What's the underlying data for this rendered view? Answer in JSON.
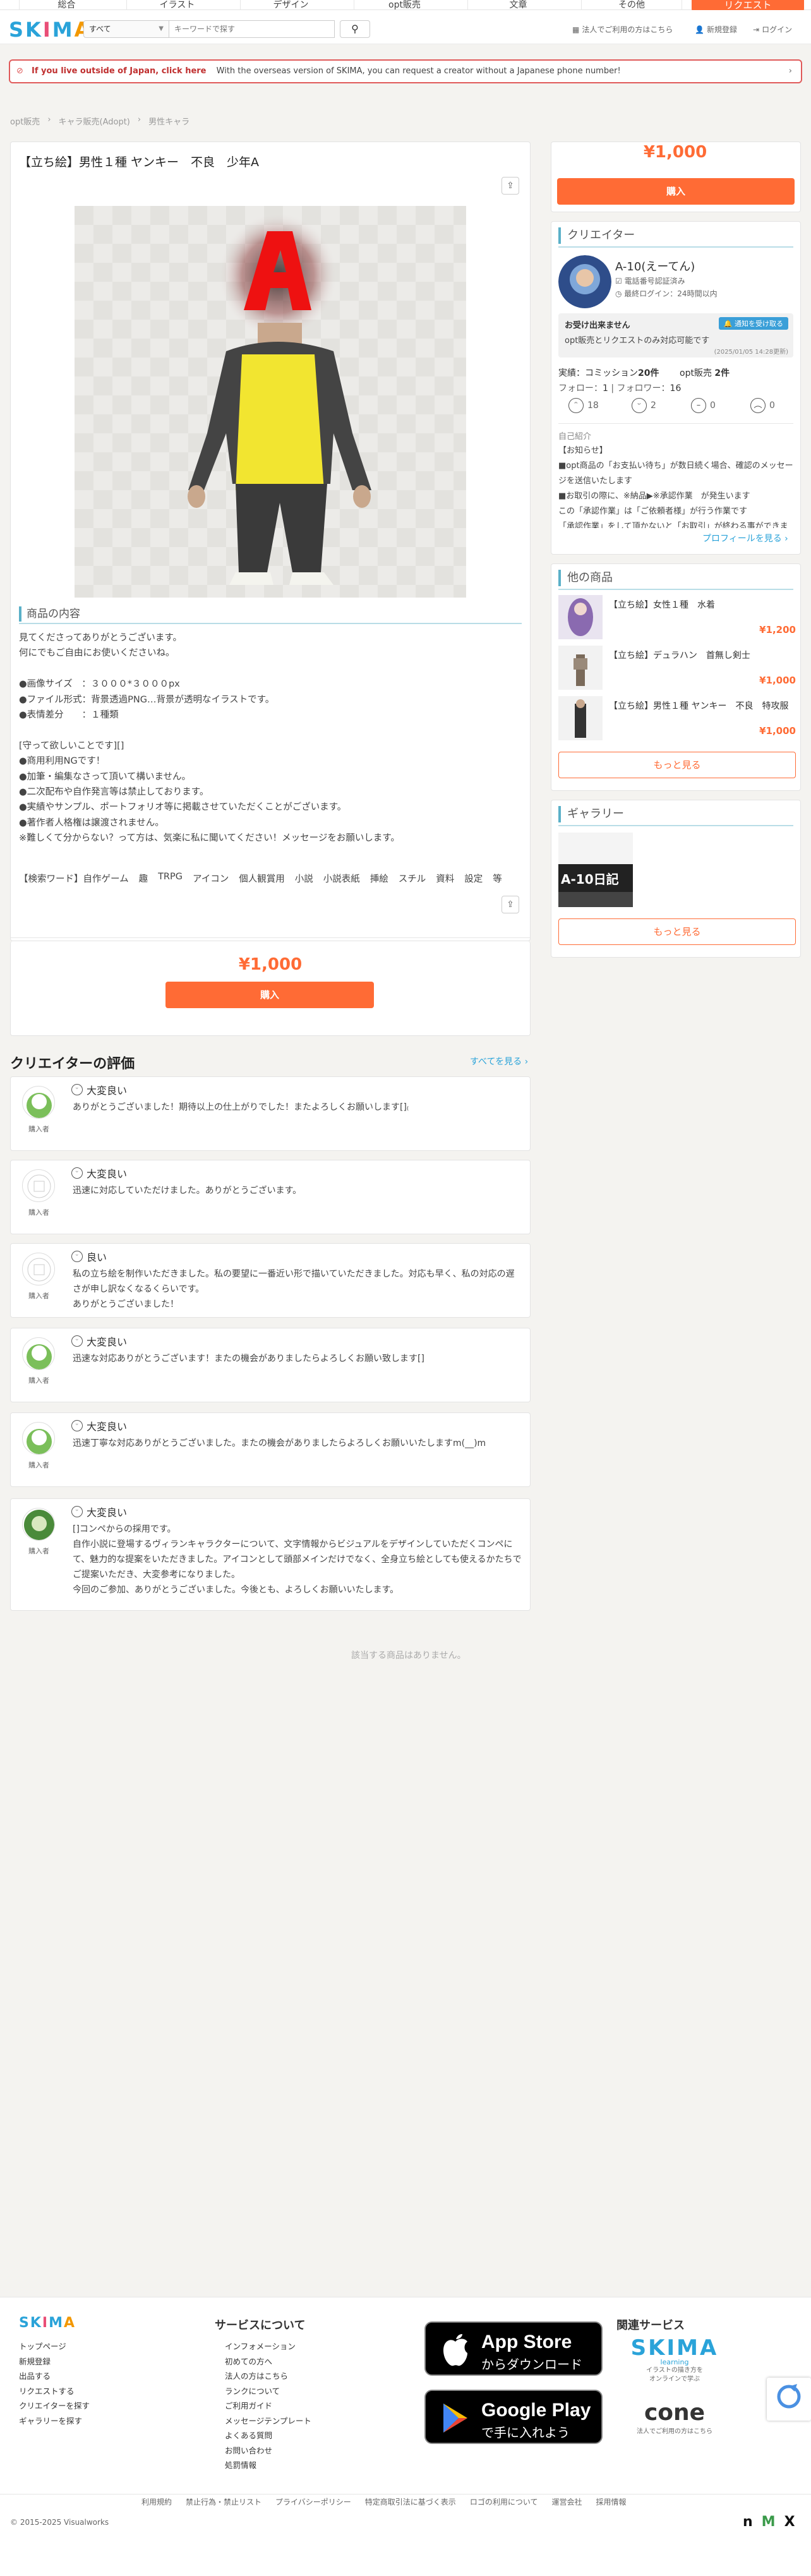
{
  "nav": {
    "items": [
      "総合",
      "イラスト",
      "デザイン",
      "opt販売",
      "文章",
      "その他"
    ],
    "request": "リクエスト"
  },
  "header": {
    "logo": [
      "S",
      "K",
      "I",
      "M",
      "A"
    ],
    "category": "すべて",
    "search_placeholder": "キーワードで探す",
    "corp_link": "法人でご利用の方はこちら",
    "signup": "新規登録",
    "login": "ログイン"
  },
  "banner": {
    "bold": "If you live outside of Japan, click here",
    "text": "With the overseas version of SKIMA, you can request a creator without a Japanese phone number!"
  },
  "breadcrumb": [
    "opt販売",
    "キャラ販売(Adopt)",
    "男性キャラ"
  ],
  "product": {
    "title": "【立ち絵】男性１種 ヤンキー　不良　少年A",
    "content_head": "商品の内容",
    "description": "見てくださってありがとうございます。\n何にでもご自由にお使いくださいね。\n\n●画像サイズ　：３０００*３０００px\n●ファイル形式：背景透過PNG…背景が透明なイラストです。\n●表情差分　　：１種類\n\n[守って欲しいことです][]\n●商用利用NGです！\n●加筆・編集なさって頂いて構いません。\n●二次配布や自作発言等は禁止しております。\n●実績やサンプル、ポートフォリオ等に掲載させていただくことがございます。\n●著作者人格権は譲渡されません。\n※難しくて分からない？って方は、気楽に私に聞いてください！メッセージをお願いします。",
    "keywords": [
      "【検索ワード】自作ゲーム",
      "趣",
      "TRPG",
      "アイコン",
      "個人観賞用",
      "小説",
      "小説表紙",
      "挿絵",
      "スチル",
      "資料",
      "設定",
      "等"
    ],
    "price": "¥1,000",
    "buy": "購入"
  },
  "reviews": {
    "heading": "クリエイターの評価",
    "see_all": "すべてを見る ›",
    "items": [
      {
        "rating": "大変良い",
        "role": "購入者",
        "text": "ありがとうございました！期待以上の仕上がりでした！またよろしくお願いします[]₍"
      },
      {
        "rating": "大変良い",
        "role": "購入者",
        "text": "迅速に対応していただけました。ありがとうございます。"
      },
      {
        "rating": "良い",
        "role": "購入者",
        "text": "私の立ち絵を制作いただきました。私の要望に一番近い形で描いていただきました。対応も早く、私の対応の遅さが申し訳なくなるくらいです。\nありがとうございました！"
      },
      {
        "rating": "大変良い",
        "role": "購入者",
        "text": "迅速な対応ありがとうございます！またの機会がありましたらよろしくお願い致します[]"
      },
      {
        "rating": "大変良い",
        "role": "購入者",
        "text": "迅速丁寧な対応ありがとうございました。またの機会がありましたらよろしくお願いいたしますm(__)m"
      },
      {
        "rating": "大変良い",
        "role": "購入者",
        "text": "[]コンペからの採用です。\n自作小説に登場するヴィランキャラクターについて、文字情報からビジュアルをデザインしていただくコンペにて、魅力的な提案をいただきました。アイコンとして頭部メインだけでなく、全身立ち絵としても使えるかたちでご提案いただき、大変参考になりました。\n今回のご参加、ありがとうございました。今後とも、よろしくお願いいたします。"
      }
    ]
  },
  "related_empty": "該当する商品はありません。",
  "sidebar": {
    "price": "¥1,000",
    "buy": "購入",
    "creator_head": "クリエイター",
    "creator_name": "A-10(えーてん)",
    "verified": "電話番号認証済み",
    "last_login": "最終ログイン：24時間以内",
    "status_title": "お受け出来ません",
    "notify": "通知を受け取る",
    "status_text": "opt販売とリクエストのみ対応可能です",
    "updated": "(2025/01/05 14:28更新)",
    "achievements": [
      {
        "label": "実績：コミッション",
        "value": "20件"
      },
      {
        "label": "opt販売",
        "value": "2件"
      }
    ],
    "follow": "フォロー：",
    "follow_count": "1",
    "follower": "フォロワー：",
    "follower_count": "16",
    "feedback": [
      "18",
      "2",
      "0",
      "0"
    ],
    "intro_label": "自己紹介",
    "intro": "【お知らせ】\n■opt商品の「お支払い待ち」が数日続く場合、確認のメッセージを送信いたします\n■お取引の際に、※納品▶※承認作業　が発生います\nこの「承認作業」は「ご依頼者様」が行う作業です\n「承認作業」をして頂かないと「お取引」が終わる事ができません",
    "profile_link": "プロフィールを見る ›",
    "others_head": "他の商品",
    "others": [
      {
        "title": "【立ち絵】女性１種　水着",
        "price": "¥1,200"
      },
      {
        "title": "【立ち絵】デュラハン　首無し剣士",
        "price": "¥1,000"
      },
      {
        "title": "【立ち絵】男性１種 ヤンキー　不良　特攻服",
        "price": "¥1,000"
      }
    ],
    "more": "もっと見る",
    "gallery_head": "ギャラリー",
    "gallery_caption": "A-10日記",
    "gallery_more": "もっと見る"
  },
  "footer": {
    "about_list": [
      "トップページ",
      "新規登録",
      "出品する",
      "リクエストする",
      "クリエイターを探す",
      "ギャラリーを探す"
    ],
    "service_head": "サービスについて",
    "service_list": [
      "インフォメーション",
      "初めての方へ",
      "法人の方はこちら",
      "ランクについて",
      "ご利用ガイド",
      "メッセージテンプレート",
      "よくある質問",
      "お問い合わせ",
      "処罰情報"
    ],
    "appstore_top": "App Store",
    "appstore_bottom": "からダウンロード",
    "googleplay_top": "Google Play",
    "googleplay_bottom": "で手に入れよう",
    "related_head": "関連サービス",
    "learning": "SKIMA",
    "learning_sub": "learning",
    "learning_desc": "イラストの描き方を\nオンラインで学ぶ",
    "cone": "cone",
    "cone_desc": "法人でご利用の方はこちら",
    "links": [
      "利用規約",
      "禁止行為・禁止リスト",
      "プライバシーポリシー",
      "特定商取引法に基づく表示",
      "ロゴの利用について",
      "運営会社",
      "採用情報"
    ],
    "copyright": "© 2015-2025 Visualworks"
  },
  "colors": {
    "accent": "#ff6b35",
    "link": "#2aa3d9",
    "section": "#5ab0c8"
  }
}
